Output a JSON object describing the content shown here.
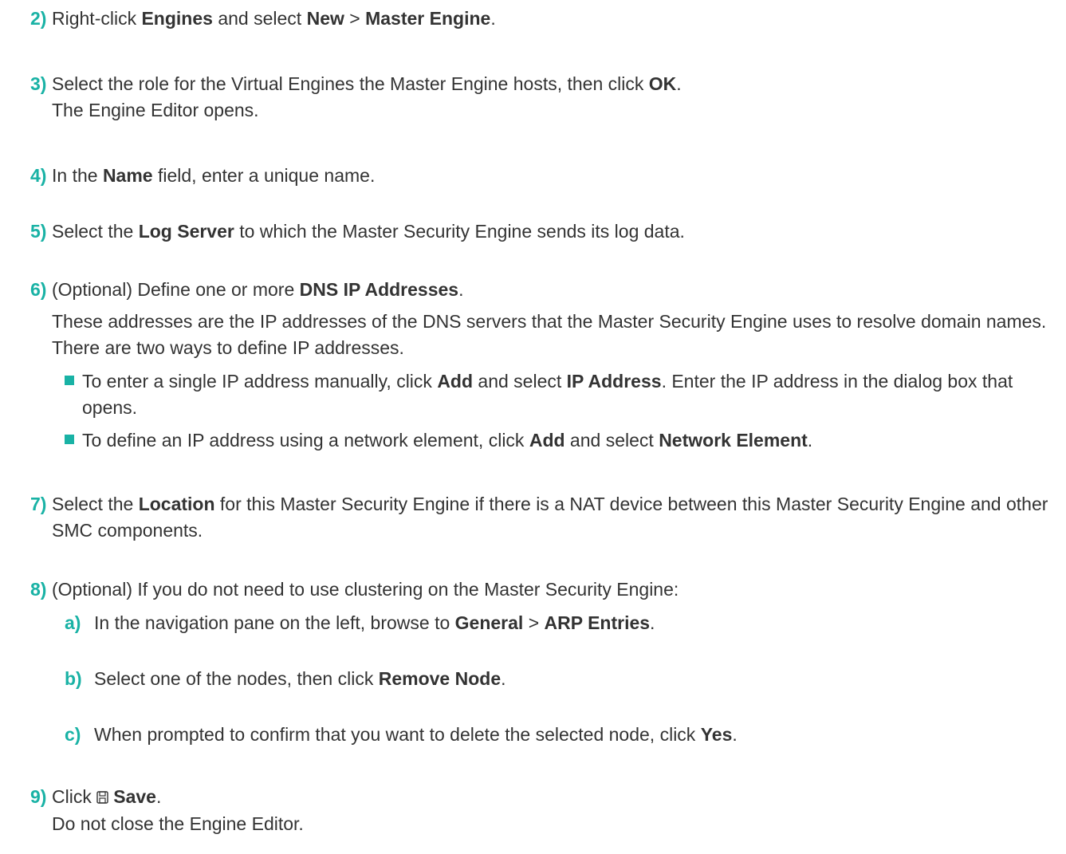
{
  "steps": {
    "s2": {
      "num": "2)",
      "t1": "Right-click ",
      "b1": "Engines",
      "t2": " and select ",
      "b2": "New",
      "t3": " > ",
      "b3": "Master Engine",
      "t4": "."
    },
    "s3": {
      "num": "3)",
      "t1": "Select the role for the Virtual Engines the Master Engine hosts, then click ",
      "b1": "OK",
      "t2": ".",
      "result": "The Engine Editor opens."
    },
    "s4": {
      "num": "4)",
      "t1": "In the ",
      "b1": "Name",
      "t2": " field, enter a unique name."
    },
    "s5": {
      "num": "5)",
      "t1": "Select the ",
      "b1": "Log Server",
      "t2": " to which the Master Security Engine sends its log data."
    },
    "s6": {
      "num": "6)",
      "t1": "(Optional) Define one or more ",
      "b1": "DNS IP Addresses",
      "t2": ".",
      "para": "These addresses are the IP addresses of the DNS servers that the Master Security Engine uses to resolve domain names. There are two ways to define IP addresses.",
      "bullets": [
        {
          "t1": "To enter a single IP address manually, click ",
          "b1": "Add",
          "t2": " and select ",
          "b2": "IP Address",
          "t3": ". Enter the IP address in the dialog box that opens."
        },
        {
          "t1": "To define an IP address using a network element, click ",
          "b1": "Add",
          "t2": " and select ",
          "b2": "Network Element",
          "t3": "."
        }
      ]
    },
    "s7": {
      "num": "7)",
      "t1": "Select the ",
      "b1": "Location",
      "t2": " for this Master Security Engine if there is a NAT device between this Master Security Engine and other SMC components."
    },
    "s8": {
      "num": "8)",
      "t1": "(Optional) If you do not need to use clustering on the Master Security Engine:",
      "subs": [
        {
          "num": "a)",
          "t1": "In the navigation pane on the left, browse to ",
          "b1": "General",
          "t2": " > ",
          "b2": "ARP Entries",
          "t3": "."
        },
        {
          "num": "b)",
          "t1": "Select one of the nodes, then click ",
          "b1": "Remove Node",
          "t2": "."
        },
        {
          "num": "c)",
          "t1": "When prompted to confirm that you want to delete the selected node, click ",
          "b1": "Yes",
          "t2": "."
        }
      ]
    },
    "s9": {
      "num": "9)",
      "t1": "Click ",
      "icon": "save-icon",
      "b1": "Save",
      "t2": ".",
      "result": "Do not close the Engine Editor."
    }
  },
  "colors": {
    "accent": "#19b2a5",
    "text": "#333333"
  }
}
